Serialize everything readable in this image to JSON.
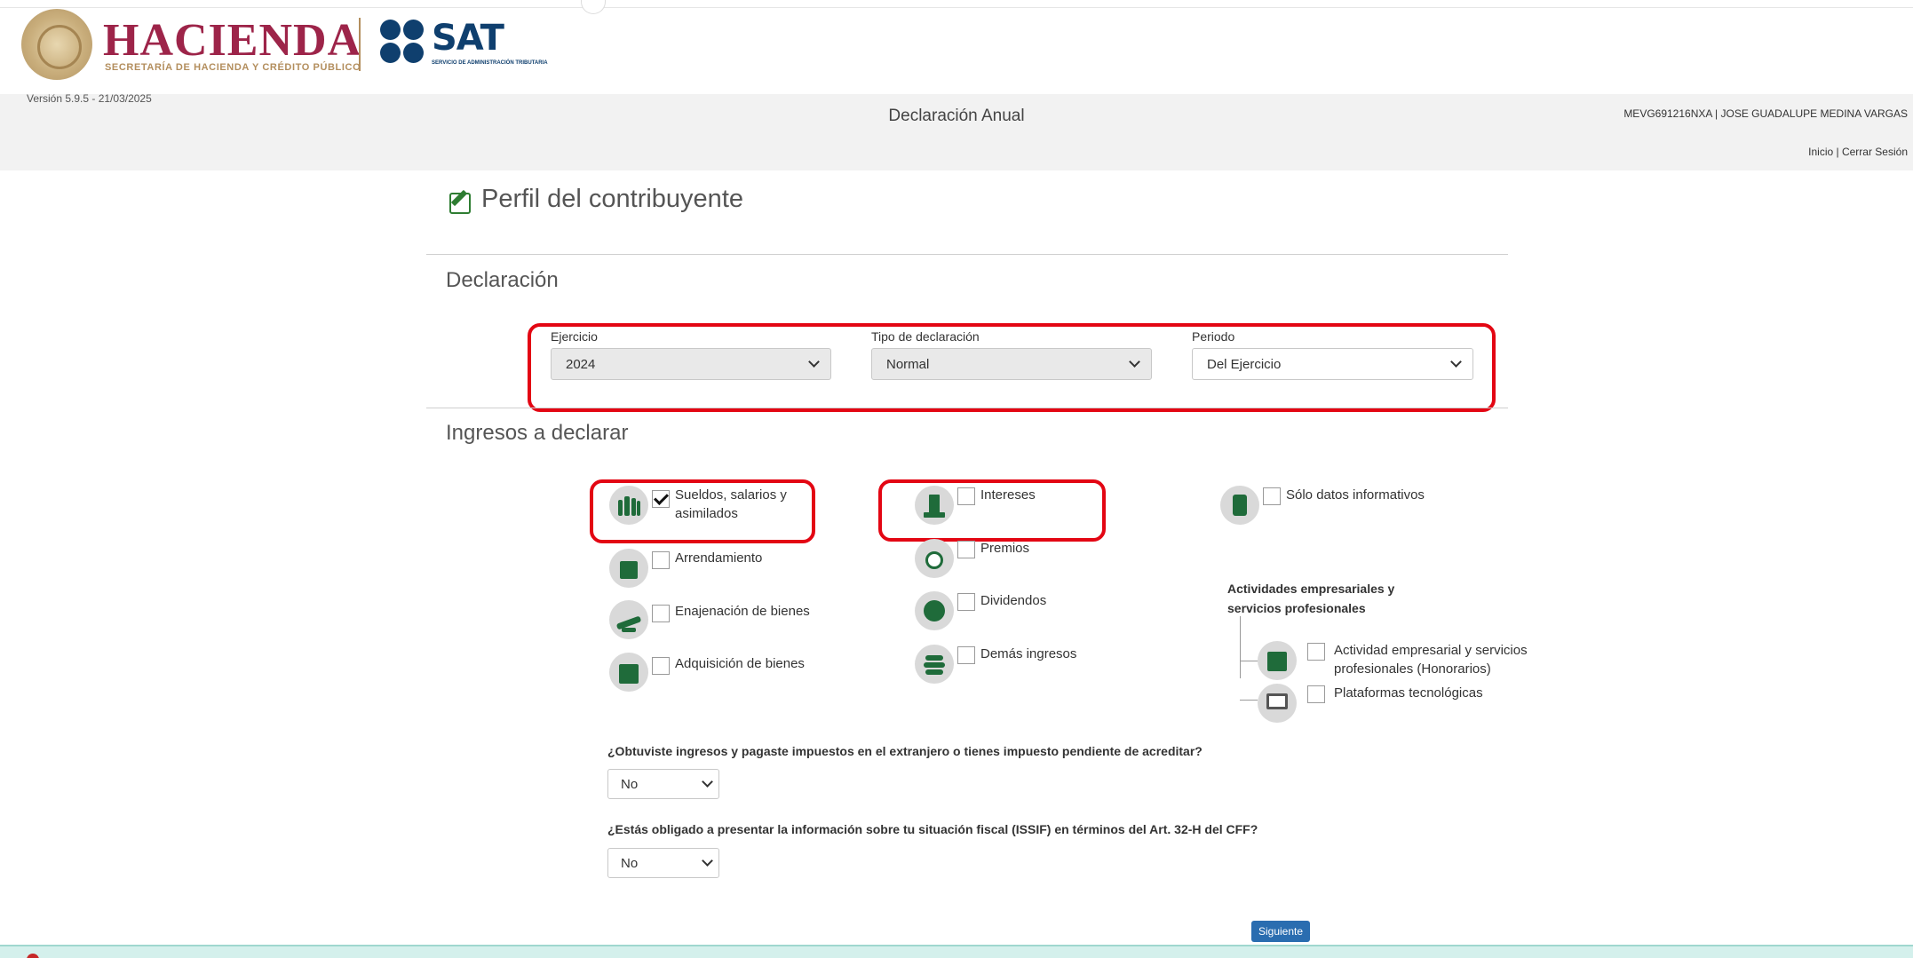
{
  "header": {
    "brand_main": "HACIENDA",
    "brand_sub": "SECRETARÍA DE HACIENDA Y CRÉDITO PÚBLICO",
    "sat_name": "SAT",
    "sat_sub": "SERVICIO DE ADMINISTRACIÓN TRIBUTARIA",
    "version": "Versión 5.9.5 - 21/03/2025",
    "page_heading": "Declaración Anual",
    "user": "MEVG691216NXA | JOSE GUADALUPE MEDINA VARGAS",
    "links": "Inicio | Cerrar Sesión"
  },
  "title": "Perfil del contribuyente",
  "declaracion": {
    "section": "Declaración",
    "ejercicio": {
      "label": "Ejercicio",
      "value": "2024"
    },
    "tipo": {
      "label": "Tipo de declaración",
      "value": "Normal"
    },
    "periodo": {
      "label": "Periodo",
      "value": "Del Ejercicio"
    }
  },
  "ingresos": {
    "section": "Ingresos a declarar",
    "sueldos": {
      "label": "Sueldos, salarios y asimilados",
      "checked": true
    },
    "arrendamiento": {
      "label": "Arrendamiento",
      "checked": false
    },
    "enajenacion": {
      "label": "Enajenación de bienes",
      "checked": false
    },
    "adquisicion": {
      "label": "Adquisición de bienes",
      "checked": false
    },
    "intereses": {
      "label": "Intereses",
      "checked": false
    },
    "premios": {
      "label": "Premios",
      "checked": false
    },
    "dividendos": {
      "label": "Dividendos",
      "checked": false
    },
    "demas": {
      "label": "Demás ingresos",
      "checked": false
    },
    "solo_datos": {
      "label": "Sólo datos informativos",
      "checked": false
    },
    "actividades_title": "Actividades empresariales y servicios profesionales",
    "actividad_empresarial": {
      "label": "Actividad empresarial y servicios profesionales (Honorarios)",
      "checked": false
    },
    "plataformas": {
      "label": "Plataformas tecnológicas",
      "checked": false
    }
  },
  "questions": {
    "q1": {
      "text": "¿Obtuviste ingresos y pagaste impuestos en el extranjero o tienes impuesto pendiente de acreditar?",
      "value": "No"
    },
    "q2": {
      "text": "¿Estás obligado a presentar la información sobre tu situación fiscal (ISSIF) en términos del Art. 32-H del CFF?",
      "value": "No"
    }
  },
  "next_button": "Siguiente",
  "colors": {
    "hacienda": "#9d2449",
    "sat": "#0f3f6e",
    "highlight": "#e30613",
    "icon_green": "#1f6b3a",
    "button": "#2a6db0"
  }
}
